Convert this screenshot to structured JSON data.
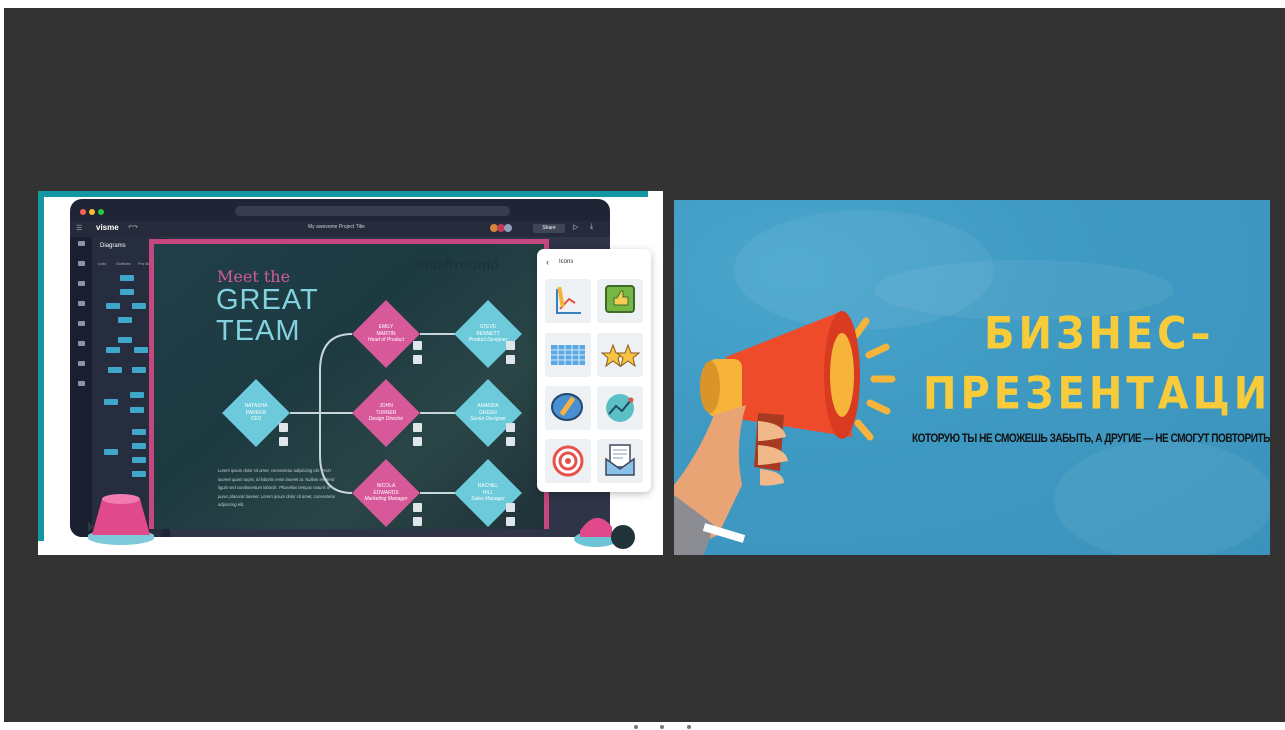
{
  "left_slide": {
    "editor": {
      "brand": "visme",
      "project_title": "My awesome Project Title",
      "share_label": "Share",
      "panel_title": "Diagrams",
      "panel_tabs": [
        "Lists",
        "Outlines",
        "Pro Builder"
      ]
    },
    "slide": {
      "heading_small": "Meet the",
      "heading_line1": "GREAT",
      "heading_line2": "TEAM",
      "logo_text": "mashroomö",
      "people": [
        {
          "name1": "NATASHA",
          "name2": "PARKER",
          "role": "CEO"
        },
        {
          "name1": "EMILY",
          "name2": "MARTIN",
          "role": "Head of Product"
        },
        {
          "name1": "JOHN",
          "name2": "TURNER",
          "role": "Design Director"
        },
        {
          "name1": "NICOLA",
          "name2": "EDWARDS",
          "role": "Marketing Manager"
        },
        {
          "name1": "STEVE",
          "name2": "BENNETT",
          "role": "Product Designer"
        },
        {
          "name1": "AMANDA",
          "name2": "GREEN",
          "role": "Senior Designer"
        },
        {
          "name1": "RACHEL",
          "name2": "HILL",
          "role": "Sales Manager"
        }
      ],
      "lorem": "Lorem ipsum dolor sit amet, consectetur adipiscing elit. Proin laoreet quam turpis, id lobortis enim laoreet at. Nullam eleifend ligula sed condimentum lobortis. Phasellus tempus mauris in purus placerat laoreet. Lorem ipsum dolor sit amet, consectetur adipiscing elit."
    },
    "icons_popup": {
      "title": "Icons",
      "icons": [
        "chart-pencil-icon",
        "thumbs-up-icon",
        "spreadsheet-icon",
        "stars-icon",
        "chat-pencil-icon",
        "growth-chart-icon",
        "target-icon",
        "mail-document-icon"
      ]
    }
  },
  "right_slide": {
    "title_line1": "БИЗНЕС–",
    "title_line2": "ПРЕЗЕНТАЦИЯ",
    "subtitle": "КОТОРУЮ ТЫ НЕ СМОЖЕШЬ ЗАБЫТЬ, А ДРУГИЕ — НЕ СМОГУТ ПОВТОРИТЬ",
    "colors": {
      "background": "#3f9ac3",
      "title": "#f7cb3a",
      "megaphone": "#ee4b2b"
    }
  },
  "pager": {
    "total": 4,
    "active": 1
  }
}
